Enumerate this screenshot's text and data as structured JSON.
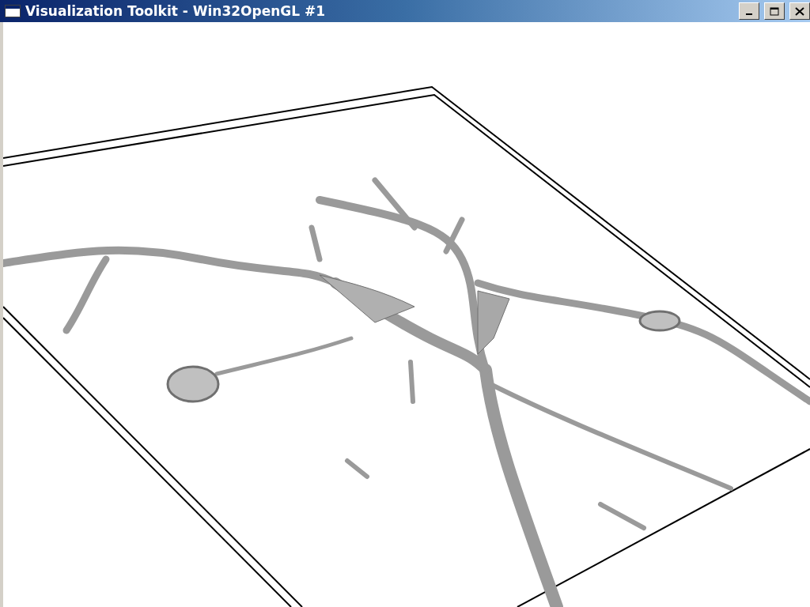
{
  "window": {
    "title": "Visualization Toolkit - Win32OpenGL #1"
  }
}
